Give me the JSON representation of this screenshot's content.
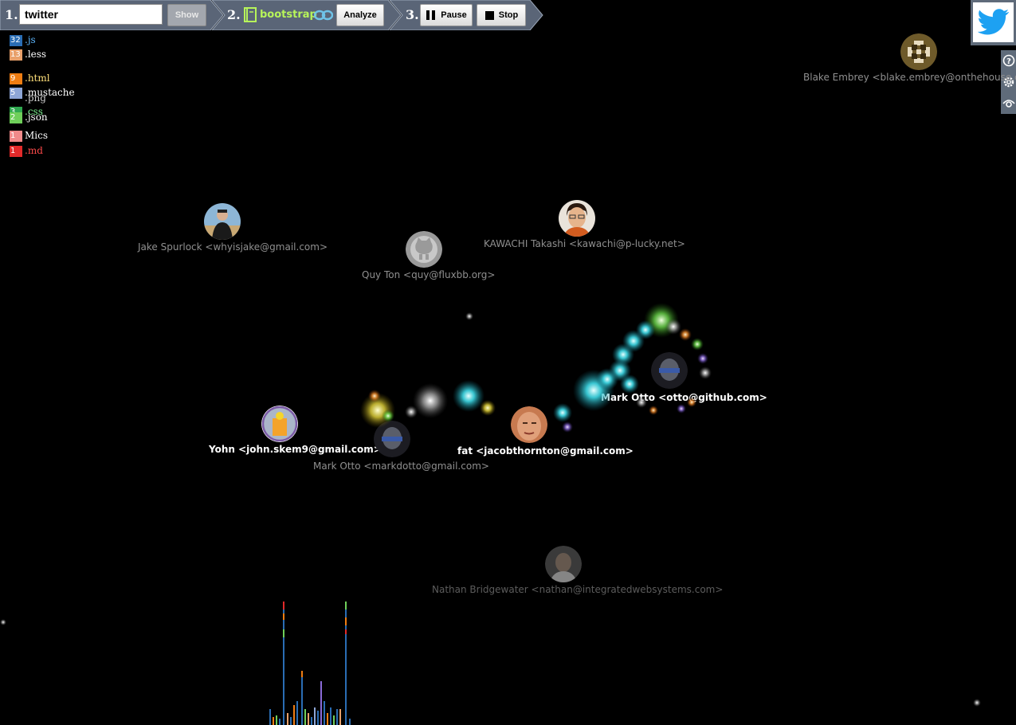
{
  "toolbar": {
    "step1_num": "1.",
    "step2_num": "2.",
    "step3_num": "3.",
    "repo_input_value": "twitter",
    "show_label": "Show",
    "repo_name": "bootstrap",
    "analyze_label": "Analyze",
    "pause_label": "Pause",
    "stop_label": "Stop"
  },
  "legend": {
    "items": [
      {
        "count": "32",
        "ext": ".js",
        "color": "#2a6db4",
        "text_color": "#5fb8ff"
      },
      {
        "count": "13",
        "ext": ".less",
        "color": "#e8a06a",
        "text_color": "#ffffff"
      },
      {
        "count": "9",
        "ext": ".html",
        "color": "#ef7d12",
        "text_color": "#ffe07a"
      },
      {
        "count": "5",
        "ext": ".mustache",
        "color": "#8ea6d6",
        "text_color": "#ffffff"
      },
      {
        "count": "",
        "ext": ".png",
        "color": "#8ea6d6",
        "text_color": "#cfcfcf"
      },
      {
        "count": "3",
        "ext": ".css",
        "color": "#2fa84f",
        "text_color": "#7cf08f"
      },
      {
        "count": "2",
        "ext": ".json",
        "color": "#6fcf5a",
        "text_color": "#ffffff"
      },
      {
        "count": "1",
        "ext": "Mics",
        "color": "#f08a8a",
        "text_color": "#ffffff"
      },
      {
        "count": "1",
        "ext": ".md",
        "color": "#e22a2a",
        "text_color": "#ff4a4a"
      }
    ]
  },
  "users": {
    "blake": "Blake Embrey <blake.embrey@onthehouse.c",
    "jake": "Jake Spurlock <whyisjake@gmail.com>",
    "kawachi": "KAWACHI Takashi <kawachi@p-lucky.net>",
    "quy": "Quy Ton <quy@fluxbb.org>",
    "otto_github": "Mark Otto <otto@github.com>",
    "yohn": "Yohn <john.skem9@gmail.com>",
    "fat": "fat <jacobthornton@gmail.com>",
    "otto_gmail": "Mark Otto <markdotto@gmail.com>",
    "nathan": "Nathan Bridgewater <nathan@integratedwebsystems.com>"
  },
  "icons": {
    "twitter": "twitter-bird-icon",
    "help": "help-icon",
    "settings": "gear-icon",
    "view": "eye-icon",
    "pause": "pause-icon",
    "stop": "stop-icon",
    "repo": "book-icon",
    "link": "link-icon"
  },
  "colors": {
    "toolbar_bg": "#5a6577",
    "accent_green": "#b7f45a",
    "twitter_blue": "#1da1f2"
  }
}
